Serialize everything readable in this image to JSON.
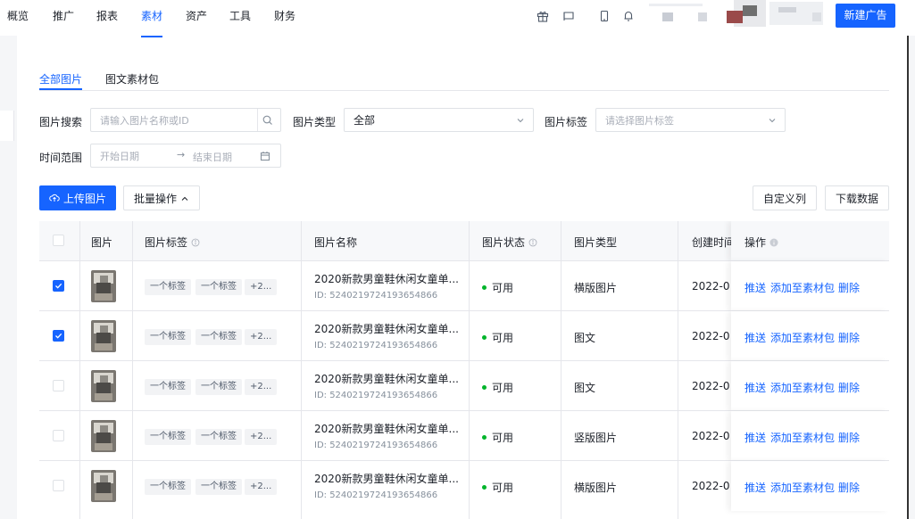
{
  "nav": {
    "items": [
      {
        "label": "概览"
      },
      {
        "label": "推广"
      },
      {
        "label": "报表"
      },
      {
        "label": "素材"
      },
      {
        "label": "资产"
      },
      {
        "label": "工具"
      },
      {
        "label": "财务"
      }
    ],
    "active": "素材",
    "new_ad_button": "新建广告",
    "icons": [
      "gift-icon",
      "message-icon",
      "mobile-icon",
      "bell-icon"
    ]
  },
  "tabs": [
    {
      "label": "全部图片"
    },
    {
      "label": "图文素材包"
    }
  ],
  "active_tab": "全部图片",
  "filters": {
    "search_label": "图片搜索",
    "search_placeholder": "请输入图片名称或ID",
    "type_label": "图片类型",
    "type_value": "全部",
    "tag_label": "图片标签",
    "tag_placeholder": "请选择图片标签",
    "time_label": "时间范围",
    "start_placeholder": "开始日期",
    "end_placeholder": "结束日期"
  },
  "actions": {
    "upload": "上传图片",
    "batch": "批量操作",
    "custom_columns": "自定义列",
    "download": "下载数据"
  },
  "table": {
    "headers": {
      "image": "图片",
      "tags": "图片标签",
      "name": "图片名称",
      "status": "图片状态",
      "type": "图片类型",
      "created": "创建时间",
      "ops": "操作"
    },
    "rows": [
      {
        "checked": true,
        "tags": [
          "一个标签",
          "一个标签",
          "+2..."
        ],
        "name": "2020新款男童鞋休闲女童单...",
        "id": "ID: 5240219724193654866",
        "status": "可用",
        "type": "横版图片",
        "created": "2022-0",
        "ops": [
          "推送",
          "添加至素材包",
          "删除"
        ]
      },
      {
        "checked": true,
        "tags": [
          "一个标签",
          "一个标签",
          "+2..."
        ],
        "name": "2020新款男童鞋休闲女童单...",
        "id": "ID: 5240219724193654866",
        "status": "可用",
        "type": "图文",
        "created": "2022-0",
        "ops": [
          "推送",
          "添加至素材包",
          "删除"
        ]
      },
      {
        "checked": false,
        "tags": [
          "一个标签",
          "一个标签",
          "+2..."
        ],
        "name": "2020新款男童鞋休闲女童单...",
        "id": "ID: 5240219724193654866",
        "status": "可用",
        "type": "图文",
        "created": "2022-0",
        "ops": [
          "推送",
          "添加至素材包",
          "删除"
        ]
      },
      {
        "checked": false,
        "tags": [
          "一个标签",
          "一个标签",
          "+2..."
        ],
        "name": "2020新款男童鞋休闲女童单...",
        "id": "ID: 5240219724193654866",
        "status": "可用",
        "type": "竖版图片",
        "created": "2022-0",
        "ops": [
          "推送",
          "添加至素材包",
          "删除"
        ]
      },
      {
        "checked": false,
        "tags": [
          "一个标签",
          "一个标签",
          "+2..."
        ],
        "name": "2020新款男童鞋休闲女童单...",
        "id": "ID: 5240219724193654866",
        "status": "可用",
        "type": "横版图片",
        "created": "2022-0",
        "ops": [
          "推送",
          "添加至素材包",
          "删除"
        ]
      }
    ]
  },
  "colors": {
    "primary": "#1664ff",
    "status_ok": "#00b42a"
  }
}
